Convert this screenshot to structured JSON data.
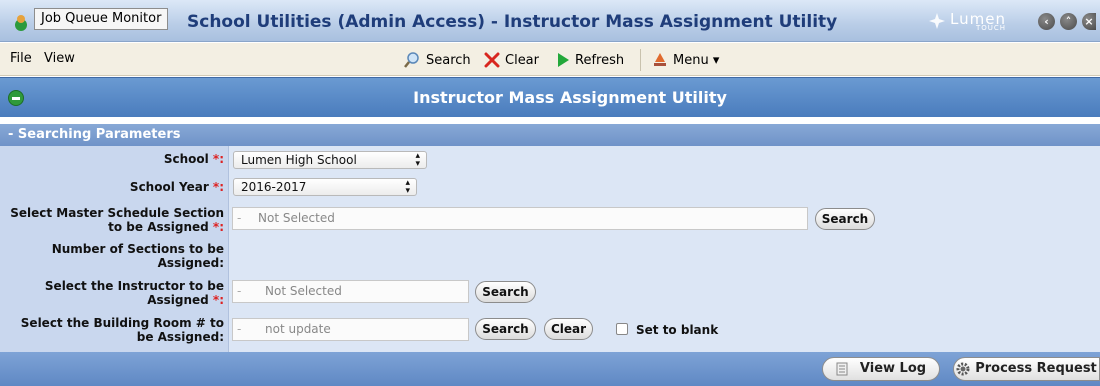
{
  "window": {
    "tab_label": "Job Queue Monitor",
    "title": "School Utilities (Admin Access) - Instructor Mass Assignment Utility",
    "logo_text": "Lumen",
    "logo_sub": "TOUCH"
  },
  "menu": {
    "file": "File",
    "view": "View"
  },
  "toolbar": {
    "search": "Search",
    "clear": "Clear",
    "refresh": "Refresh",
    "menu": "Menu ▾"
  },
  "header": {
    "title": "Instructor Mass Assignment Utility"
  },
  "params": {
    "title": "- Searching Parameters",
    "required_mark": "*:",
    "school_label": "School ",
    "school_value": "Lumen High School",
    "school_year_label": "School Year ",
    "school_year_value": "2016-2017",
    "section_label_1": "Select Master Schedule Section",
    "section_label_2": "to be Assigned ",
    "section_dash": "-",
    "section_value": "Not Selected",
    "num_sections_label_1": "Number of Sections to be",
    "num_sections_label_2": "Assigned:",
    "instructor_label_1": "Select the Instructor to be",
    "instructor_label_2": "Assigned ",
    "instructor_dash": "-",
    "instructor_value": "Not Selected",
    "room_label_1": "Select the Building Room # to",
    "room_label_2": "be Assigned:",
    "room_dash": "-",
    "room_value": "not update",
    "search_button": "Search",
    "clear_button": "Clear",
    "blank_label": "Set to blank"
  },
  "footer": {
    "view_log": "View Log",
    "process_request": "Process Request"
  },
  "colors": {
    "title_text": "#1f3d7a",
    "header_bg": "#4a7cbd",
    "form_bg": "#dce6f5",
    "required": "#dd2222"
  }
}
